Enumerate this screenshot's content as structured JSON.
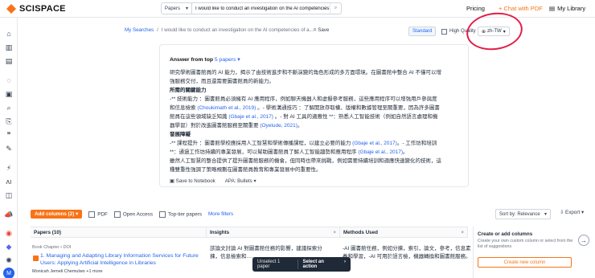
{
  "brand": {
    "name": "SCISPACE"
  },
  "search": {
    "scope": "Papers",
    "query": "I would like to conduct an investigation on the AI competencies"
  },
  "nav": {
    "pricing": "Pricing",
    "chat": "+ Chat with PDF",
    "library": "My Library"
  },
  "sidebar_icons": [
    "home-icon",
    "library-icon",
    "document-icon",
    "notebook-icon",
    "chat-icon",
    "search-icon",
    "extract-icon",
    "quote-icon",
    "paraphrase-icon",
    "ai-detector-icon",
    "translate-icon",
    "megaphone-icon",
    "chrome-icon",
    "discord-icon",
    "openai-icon"
  ],
  "breadcrumb": {
    "root": "My Searches",
    "sep": "/",
    "current": "I would like to conduct an investigation on the AI competencies of a..."
  },
  "save_label": "Save",
  "modes": {
    "standard": "Standard",
    "high": "High Quality"
  },
  "language": "zh-TW",
  "answer": {
    "title_prefix": "Answer from top ",
    "title_count": "5 papers",
    "lines": [
      {
        "t": "研究學術圖書館員的 AI 能力，揭示了由技術進步和不斷演變的角色形成的多方面環境。在圖書館中整合 AI 不僅可以增"
      },
      {
        "t": "強服務交付，而且還需要圖書館員的新能力。"
      },
      {
        "t": "所需的關鍵能力"
      },
      {
        "t": "-** 技術能力 ：圖書館員必須擁有 AI 應用程序，例如聊天機器人和虛擬參考服務，這些應用程序可以增強用戶參與度"
      },
      {
        "t": "和信息檢索 ",
        "c": "(Choukimath et al., 2019)",
        "t2": " 。- 學術溝通技巧 ：了解開放存取權、版權和數據管理至關重要，因為許多圖書"
      },
      {
        "t": "館員在這些領域缺乏知識 ",
        "c": "(Gbaje et al., 2017)",
        "t2": " 。- 對 AI 工具的適應性 **：熟悉人工智能技術（例如自然語言處理和機"
      },
      {
        "t": "器學習）對於改進圖書館服務至關重要 ",
        "c": "(Oyelude, 2021)",
        "t2": "。"
      },
      {
        "t": "發展障礙"
      },
      {
        "t": "-** 課程提升 ：圖書館學校應採用人工智慧和學術傳播課程，以建立必要的能力 ",
        "c": "(Gbaje et al., 2017)",
        "t2": "。- 工作坊和培訓"
      },
      {
        "t": "**：通過工作坊持續的專業發展，可以幫助圖書館員了解人工智能趨勢和應用程序 ",
        "c": "(Gbaje et al., 2017)",
        "t2": "。"
      },
      {
        "t": "雖然人工智慧的整合提供了提升圖書館服務的機會，但同時也帶來挑戰，例如需要持續培訓和適應快速變化的技術，這"
      },
      {
        "t": "種雙重性強調了策略規劃在圖書館員教育和專業發展中的重要性。"
      }
    ],
    "save_notebook": "Save to Notebook",
    "apa": "APA: Bullets"
  },
  "filters": {
    "add_columns": "Add columns (2)",
    "pdf": "PDF",
    "open_access": "Open Access",
    "top_tier": "Top-tier papers",
    "more": "More filters"
  },
  "sort": {
    "label": "Sort by: Relevance"
  },
  "export": "Export",
  "table": {
    "headers": {
      "papers": "Papers (10)",
      "insights": "Insights",
      "methods": "Methods Used"
    },
    "row": {
      "meta": "Book Chapter • DOI",
      "title": "1. Managing and Adapting Library Information Services for Future Users: Applying Artificial Intelligence in Libraries",
      "authors": "Monicah Jemeli Chemulwo  +1 more",
      "insight": "該論文討論 AI 對圖書館任務的影響，建議探索分揀，信息檢索和……",
      "methods": "-AI 圖書館任務，例如分揀，索引，論文，參考，信息素養和學習，-AI 可用於語言檢，機器轉換和圖書館服務。"
    }
  },
  "action_bar": {
    "unselect": "Unselect 1 paper",
    "select_action": "Select an action"
  },
  "right_panel": {
    "title": "Create or add columns",
    "desc": "Create your own custom column or select from the list of suggestions",
    "button": "Create new column"
  }
}
